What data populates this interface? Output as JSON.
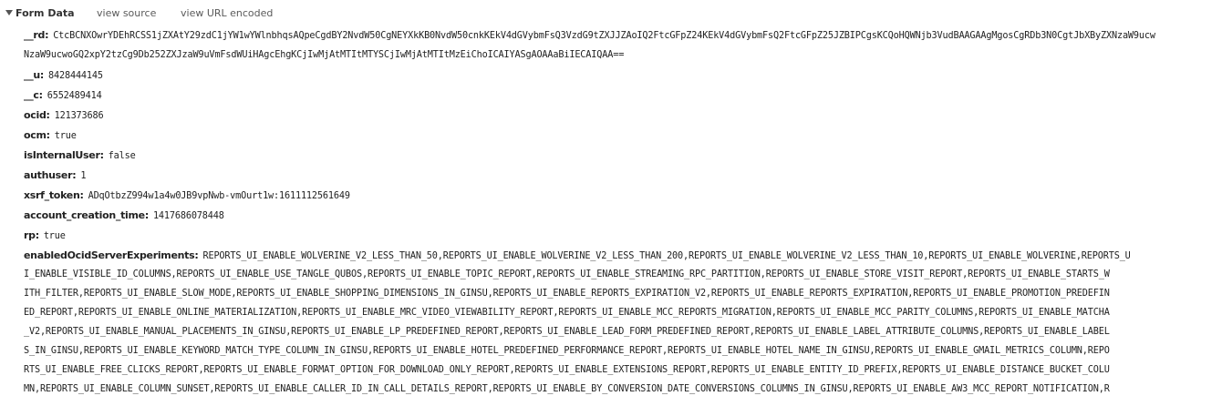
{
  "header": {
    "title": "Form Data",
    "view_source": "view source",
    "view_url_encoded": "view URL encoded"
  },
  "fields": {
    "rd": {
      "key": "__rd:",
      "value_line1": "CtcBCNXOwrYDEhRCSS1jZXAtY29zdC1jYW1wYWlnbhqsAQpeCgdBY2NvdW50CgNEYXkKB0NvdW50cnkKEkV4dGVybmFsQ3VzdG9tZXJJZAoIQ2FtcGFpZ24KEkV4dGVybmFsQ2FtcGFpZ25JZBIPCgsKCQoHQWNjb3VudBAAGAAgMgosCgRDb3N0CgtJbXByZXNzaW9ucw",
      "value_line2": "NzaW9ucwoGQ2xpY2tzCg9Db252ZXJzaW9uVmFsdWUiHAgcEhgKCjIwMjAtMTItMTYSCjIwMjAtMTItMzEiChoICAIYASgAOAAaBiIECAIQAA=="
    },
    "u": {
      "key": "__u:",
      "value": "8428444145"
    },
    "c": {
      "key": "__c:",
      "value": "6552489414"
    },
    "ocid": {
      "key": "ocid:",
      "value": "121373686"
    },
    "ocm": {
      "key": "ocm:",
      "value": "true"
    },
    "isInternalUser": {
      "key": "isInternalUser:",
      "value": "false"
    },
    "authuser": {
      "key": "authuser:",
      "value": "1"
    },
    "xsrf_token": {
      "key": "xsrf_token:",
      "value": "ADqOtbzZ994w1a4w0JB9vpNwb-vmOurt1w:1611112561649"
    },
    "account_creation_time": {
      "key": "account_creation_time:",
      "value": "1417686078448"
    },
    "rp": {
      "key": "rp:",
      "value": "true"
    },
    "enabledOcidServerExperiments": {
      "key": "enabledOcidServerExperiments:",
      "line1": "REPORTS_UI_ENABLE_WOLVERINE_V2_LESS_THAN_50,REPORTS_UI_ENABLE_WOLVERINE_V2_LESS_THAN_200,REPORTS_UI_ENABLE_WOLVERINE_V2_LESS_THAN_10,REPORTS_UI_ENABLE_WOLVERINE,REPORTS_U",
      "line2": "I_ENABLE_VISIBLE_ID_COLUMNS,REPORTS_UI_ENABLE_USE_TANGLE_QUBOS,REPORTS_UI_ENABLE_TOPIC_REPORT,REPORTS_UI_ENABLE_STREAMING_RPC_PARTITION,REPORTS_UI_ENABLE_STORE_VISIT_REPORT,REPORTS_UI_ENABLE_STARTS_W",
      "line3": "ITH_FILTER,REPORTS_UI_ENABLE_SLOW_MODE,REPORTS_UI_ENABLE_SHOPPING_DIMENSIONS_IN_GINSU,REPORTS_UI_ENABLE_REPORTS_EXPIRATION_V2,REPORTS_UI_ENABLE_REPORTS_EXPIRATION,REPORTS_UI_ENABLE_PROMOTION_PREDEFIN",
      "line4": "ED_REPORT,REPORTS_UI_ENABLE_ONLINE_MATERIALIZATION,REPORTS_UI_ENABLE_MRC_VIDEO_VIEWABILITY_REPORT,REPORTS_UI_ENABLE_MCC_REPORTS_MIGRATION,REPORTS_UI_ENABLE_MCC_PARITY_COLUMNS,REPORTS_UI_ENABLE_MATCHA",
      "line5": "_V2,REPORTS_UI_ENABLE_MANUAL_PLACEMENTS_IN_GINSU,REPORTS_UI_ENABLE_LP_PREDEFINED_REPORT,REPORTS_UI_ENABLE_LEAD_FORM_PREDEFINED_REPORT,REPORTS_UI_ENABLE_LABEL_ATTRIBUTE_COLUMNS,REPORTS_UI_ENABLE_LABEL",
      "line6": "S_IN_GINSU,REPORTS_UI_ENABLE_KEYWORD_MATCH_TYPE_COLUMN_IN_GINSU,REPORTS_UI_ENABLE_HOTEL_PREDEFINED_PERFORMANCE_REPORT,REPORTS_UI_ENABLE_HOTEL_NAME_IN_GINSU,REPORTS_UI_ENABLE_GMAIL_METRICS_COLUMN,REPO",
      "line7": "RTS_UI_ENABLE_FREE_CLICKS_REPORT,REPORTS_UI_ENABLE_FORMAT_OPTION_FOR_DOWNLOAD_ONLY_REPORT,REPORTS_UI_ENABLE_EXTENSIONS_REPORT,REPORTS_UI_ENABLE_ENTITY_ID_PREFIX,REPORTS_UI_ENABLE_DISTANCE_BUCKET_COLU",
      "line8": "MN,REPORTS_UI_ENABLE_COLUMN_SUNSET,REPORTS_UI_ENABLE_CALLER_ID_IN_CALL_DETAILS_REPORT,REPORTS_UI_ENABLE_BY_CONVERSION_DATE_CONVERSIONS_COLUMNS_IN_GINSU,REPORTS_UI_ENABLE_AW3_MCC_REPORT_NOTIFICATION,R"
    }
  }
}
